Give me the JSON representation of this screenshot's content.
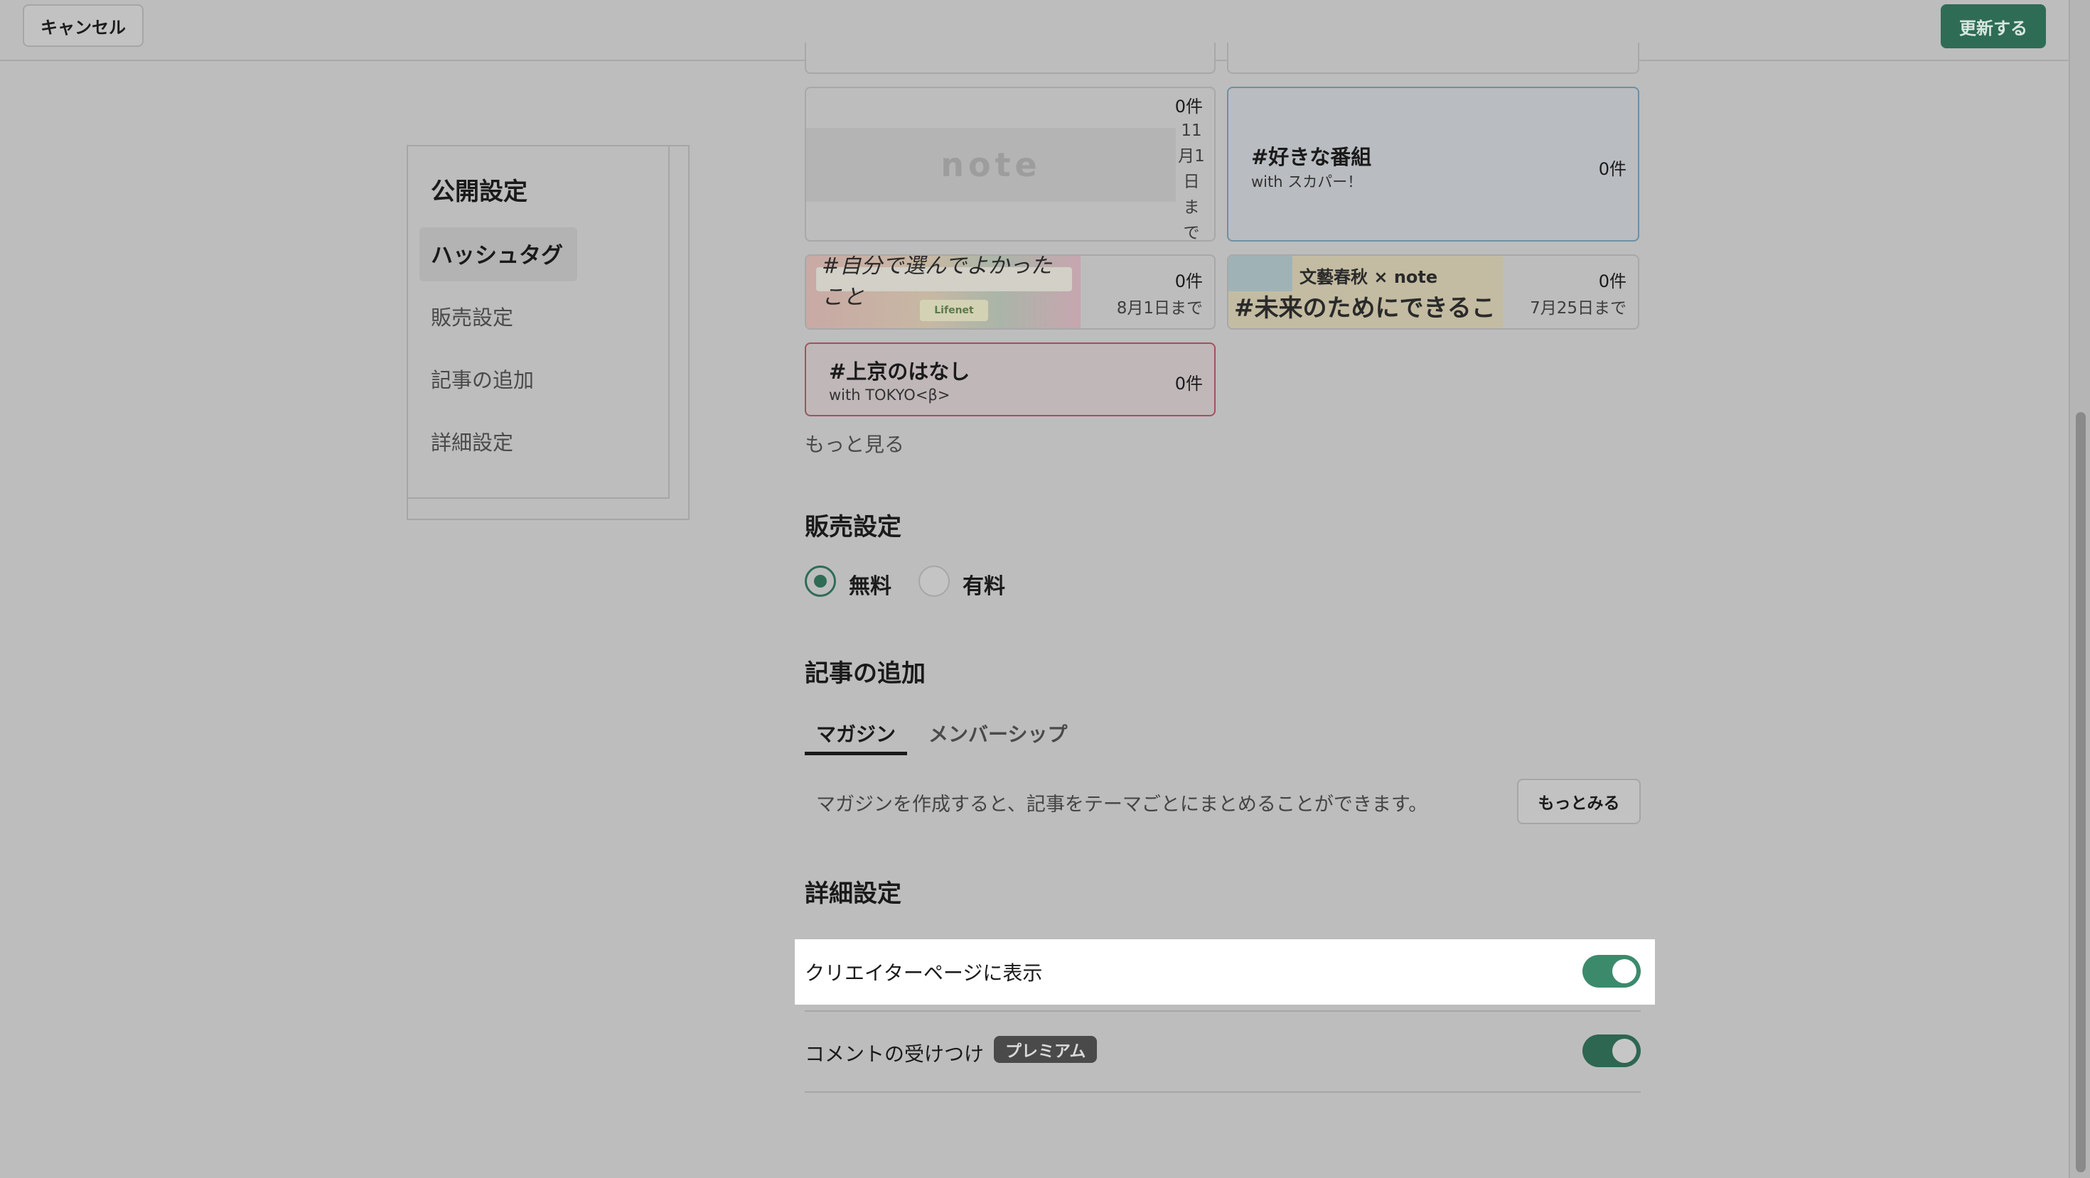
{
  "header": {
    "cancel_label": "キャンセル",
    "update_label": "更新する"
  },
  "sidebar": {
    "title": "公開設定",
    "items": [
      {
        "label": "ハッシュタグ",
        "active": true
      },
      {
        "label": "販売設定"
      },
      {
        "label": "記事の追加"
      },
      {
        "label": "詳細設定"
      }
    ]
  },
  "hashtags": {
    "cards": [
      {
        "kind": "note-placeholder",
        "logo_text": "note",
        "count": "0件",
        "deadline": "11月1日まで",
        "deadline_lines": [
          "11",
          "月1",
          "日",
          "ま",
          "で"
        ]
      },
      {
        "kind": "text",
        "title": "#好きな番組",
        "subtitle": "with スカパー！",
        "count": "0件"
      },
      {
        "kind": "banner",
        "banner_text": "#自分で選んでよかったこと",
        "banner_logo": "Lifenet",
        "count": "0件",
        "deadline": "8月1日まで"
      },
      {
        "kind": "banner",
        "banner_top": "文藝春秋 × note",
        "banner_text": "#未来のためにできること",
        "count": "0件",
        "deadline": "7月25日まで"
      },
      {
        "kind": "text",
        "title": "#上京のはなし",
        "subtitle": "with TOKYO<β>",
        "count": "0件"
      }
    ],
    "more_label": "もっと見る"
  },
  "sales": {
    "heading": "販売設定",
    "options": [
      {
        "label": "無料",
        "selected": true
      },
      {
        "label": "有料",
        "selected": false
      }
    ]
  },
  "add_article": {
    "heading": "記事の追加",
    "tabs": [
      {
        "label": "マガジン",
        "active": true
      },
      {
        "label": "メンバーシップ",
        "active": false
      }
    ],
    "magazine_text": "マガジンを作成すると、記事をテーマごとにまとめることができます。",
    "more_button": "もっとみる"
  },
  "details": {
    "heading": "詳細設定",
    "rows": [
      {
        "label": "クリエイターページに表示",
        "enabled": true
      },
      {
        "label": "コメントの受けつけ",
        "badge": "プレミアム",
        "enabled": true
      }
    ]
  },
  "colors": {
    "accent": "#2f6c55",
    "overlay": "#bdbdbd",
    "highlight": "#ffffff"
  }
}
